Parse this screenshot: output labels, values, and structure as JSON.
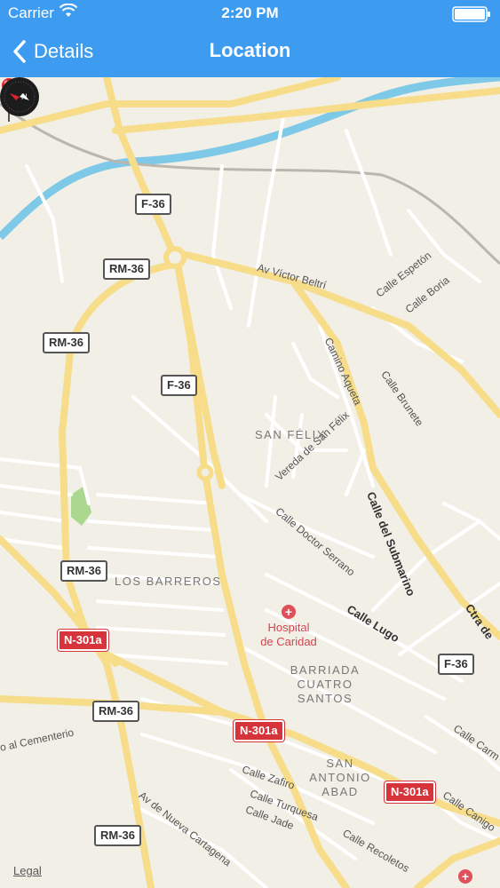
{
  "status_bar": {
    "carrier": "Carrier",
    "time": "2:20 PM"
  },
  "nav": {
    "back_label": "Details",
    "title": "Location"
  },
  "map": {
    "legal": "Legal",
    "shields": [
      "F-36",
      "RM-36",
      "RM-36",
      "F-36",
      "RM-36",
      "N-301a",
      "RM-36",
      "N-301a",
      "N-301a",
      "RM-36",
      "F-36"
    ],
    "streets": [
      "Av Víctor Beltrí",
      "Calle Espetón",
      "Calle Boria",
      "Camino Aqueta",
      "Calle Brunete",
      "Vereda de San Félix",
      "Calle del Submarino",
      "Calle Doctor Serrano",
      "Calle Lugo",
      "Ctra de",
      "Calle Carm",
      "Calle Canigo",
      "Calle Zafiro",
      "Calle Turquesa",
      "Calle Jade",
      "Calle Recoletos",
      "Av de Nueva Cartagena",
      "o al Cementerio"
    ],
    "districts": [
      "SAN FÉLIX",
      "LOS BARREROS",
      "BARRIADA CUATRO SANTOS",
      "SAN ANTONIO ABAD"
    ],
    "poi": {
      "name": "Hospital de Caridad",
      "icon": "hospital-icon"
    },
    "colors": {
      "background": "#f2efe6",
      "road": "#f7dd8a",
      "water": "#7ec8e8",
      "park": "#a9d88e",
      "accent": "#3d9cf0"
    }
  }
}
